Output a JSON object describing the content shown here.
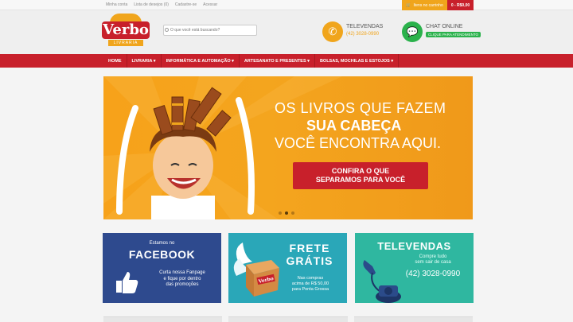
{
  "topbar": {
    "links": [
      "Minha conta",
      "Lista de desejos (0)",
      "Cadastre-se",
      "Acessar"
    ],
    "cart_label": "Itens no carrinho",
    "cart_total": "0 - R$0,00"
  },
  "header": {
    "logo_text": "Verbo",
    "logo_sub": "LIVRARIA",
    "search_placeholder": "O que você está buscando?",
    "televendas_label": "TELEVENDAS",
    "televendas_number": "(42) 3028-0990",
    "chat_label": "CHAT ONLINE",
    "chat_badge": "CLIQUE PARA ATENDIMENTO"
  },
  "nav": {
    "items": [
      "HOME",
      "LIVRARIA ▾",
      "INFORMÁTICA E AUTOMAÇÃO ▾",
      "ARTESANATO E PRESENTES ▾",
      "BOLSAS, MOCHILAS E ESTOJOS ▾"
    ]
  },
  "banner": {
    "line1": "OS LIVROS QUE FAZEM",
    "line2": "SUA CABEÇA",
    "line3": "VOCÊ ENCONTRA AQUI.",
    "cta_line1": "CONFIRA O QUE",
    "cta_line2": "SEPARAMOS PARA VOCÊ"
  },
  "cards": {
    "facebook": {
      "small": "Estamos no",
      "title": "FACEBOOK",
      "text_line1": "Curta nossa Fanpage",
      "text_line2": "e fique por dentro",
      "text_line3": "das promoções"
    },
    "frete": {
      "title1": "FRETE",
      "title2": "GRÁTIS",
      "box_text": "Verbo",
      "text_line1": "Nas compras",
      "text_line2": "acima de R$ 50,00",
      "text_line3": "para Ponta Grossa"
    },
    "televendas": {
      "title": "TELEVENDAS",
      "sub_line1": "Compre tudo",
      "sub_line2": "sem sair de casa",
      "number": "(42) 3028-0990"
    }
  },
  "colors": {
    "brand_red": "#c8202b",
    "brand_orange": "#f0a51c",
    "chat_green": "#2bb24c",
    "facebook_blue": "#2e4a8e",
    "frete_teal": "#2aa7b8",
    "televendas_green": "#2fb7a0"
  }
}
